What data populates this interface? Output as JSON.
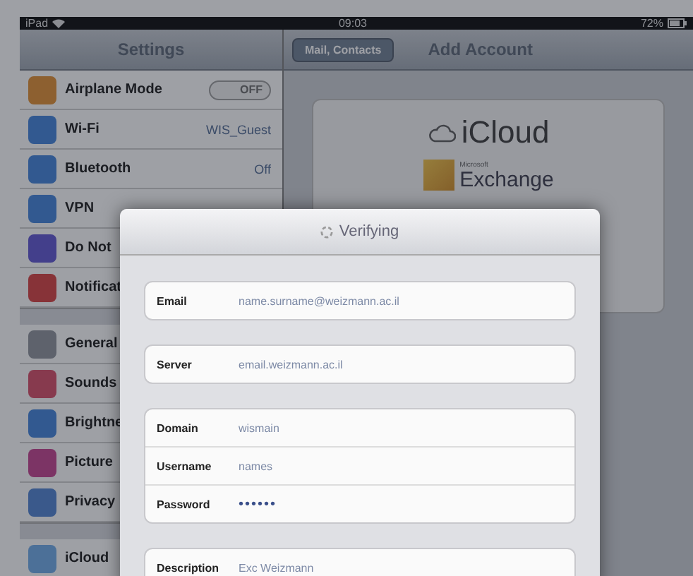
{
  "status_bar": {
    "device": "iPad",
    "time": "09:03",
    "battery": "72%"
  },
  "sidebar": {
    "title": "Settings",
    "groups": [
      {
        "items": [
          {
            "label": "Airplane Mode",
            "kind": "toggle",
            "on": false,
            "value": "OFF"
          },
          {
            "label": "Wi-Fi",
            "kind": "value",
            "value": "WIS_Guest"
          },
          {
            "label": "Bluetooth",
            "kind": "value",
            "value": "Off"
          },
          {
            "label": "VPN",
            "kind": "plain"
          },
          {
            "label": "Do Not",
            "kind": "plain"
          },
          {
            "label": "Notificat",
            "kind": "plain"
          }
        ]
      },
      {
        "items": [
          {
            "label": "General",
            "kind": "plain"
          },
          {
            "label": "Sounds",
            "kind": "plain"
          },
          {
            "label": "Brightne",
            "kind": "plain"
          },
          {
            "label": "Picture",
            "kind": "plain"
          },
          {
            "label": "Privacy",
            "kind": "plain"
          }
        ]
      },
      {
        "items": [
          {
            "label": "iCloud",
            "kind": "plain"
          }
        ]
      }
    ]
  },
  "nav": {
    "back": "Mail, Contacts",
    "title": "Add Account"
  },
  "providers": [
    {
      "name": "iCloud",
      "kind": "icloud"
    },
    {
      "name": "Exchange",
      "brand": "Microsoft",
      "kind": "exchange"
    }
  ],
  "dialog": {
    "title": "Verifying",
    "groups": [
      [
        {
          "label": "Email",
          "value": "name.surname@weizmann.ac.il"
        }
      ],
      [
        {
          "label": "Server",
          "value": "email.weizmann.ac.il"
        }
      ],
      [
        {
          "label": "Domain",
          "value": "wismain"
        },
        {
          "label": "Username",
          "value": "names"
        },
        {
          "label": "Password",
          "value": "••••••",
          "kind": "secret"
        }
      ],
      [
        {
          "label": "Description",
          "value": "Exc Weizmann"
        }
      ]
    ]
  }
}
